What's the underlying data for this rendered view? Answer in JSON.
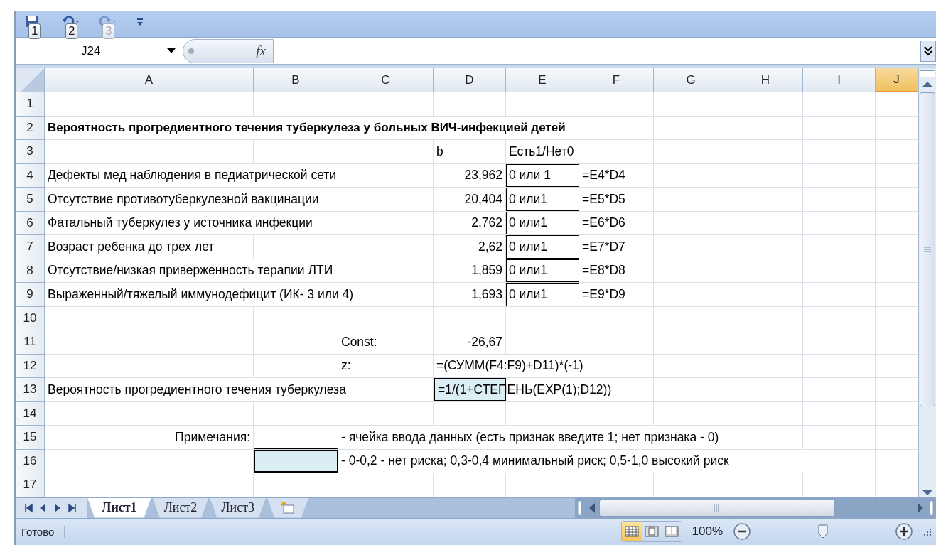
{
  "quick_access": [
    {
      "kind": "save",
      "key_tip": "1",
      "disabled": false
    },
    {
      "kind": "undo",
      "key_tip": "2",
      "disabled": false
    },
    {
      "kind": "redo",
      "key_tip": "3",
      "disabled": true
    }
  ],
  "name_box": {
    "value": "J24"
  },
  "formula_bar": {
    "fx_label": "fx"
  },
  "columns": [
    {
      "label": "A",
      "selected": false
    },
    {
      "label": "B",
      "selected": false
    },
    {
      "label": "C",
      "selected": false
    },
    {
      "label": "D",
      "selected": false
    },
    {
      "label": "E",
      "selected": false
    },
    {
      "label": "F",
      "selected": false
    },
    {
      "label": "G",
      "selected": false
    },
    {
      "label": "H",
      "selected": false
    },
    {
      "label": "I",
      "selected": false
    },
    {
      "label": "J",
      "selected": true
    }
  ],
  "rows": [
    {
      "number": "1",
      "cells": {}
    },
    {
      "number": "2",
      "cells": {
        "A": {
          "text": "Вероятность прогредиентного течения туберкулеза у больных ВИЧ-инфекцией детей",
          "kind": "bold"
        }
      }
    },
    {
      "number": "3",
      "cells": {
        "D": {
          "text": "b"
        },
        "E": {
          "text": "Есть1/Нет0"
        }
      }
    },
    {
      "number": "4",
      "cells": {
        "A": {
          "text": "Дефекты мед наблюдения в педиатрической сети"
        },
        "D": {
          "text": "23,962",
          "kind": "number"
        },
        "E": {
          "text": "0 или 1",
          "kind": "input"
        },
        "F": {
          "text": "=E4*D4"
        }
      }
    },
    {
      "number": "5",
      "cells": {
        "A": {
          "text": "Отсутствие противотуберкулезной вакцинации"
        },
        "D": {
          "text": "20,404",
          "kind": "number"
        },
        "E": {
          "text": "0 или1",
          "kind": "input"
        },
        "F": {
          "text": "=E5*D5"
        }
      }
    },
    {
      "number": "6",
      "cells": {
        "A": {
          "text": "Фатальный туберкулез у источника инфекции"
        },
        "D": {
          "text": "2,762",
          "kind": "number"
        },
        "E": {
          "text": "0 или1",
          "kind": "input"
        },
        "F": {
          "text": "=E6*D6"
        }
      }
    },
    {
      "number": "7",
      "cells": {
        "A": {
          "text": "Возраст ребенка до трех лет"
        },
        "D": {
          "text": "2,62",
          "kind": "number"
        },
        "E": {
          "text": "0 или1",
          "kind": "input"
        },
        "F": {
          "text": "=E7*D7"
        }
      }
    },
    {
      "number": "8",
      "cells": {
        "A": {
          "text": "Отсутствие/низкая приверженность терапии ЛТИ"
        },
        "D": {
          "text": "1,859",
          "kind": "number"
        },
        "E": {
          "text": "0 или1",
          "kind": "input"
        },
        "F": {
          "text": "=E8*D8"
        }
      }
    },
    {
      "number": "9",
      "cells": {
        "A": {
          "text": "Выраженный/тяжелый иммунодефицит (ИК- 3 или 4)"
        },
        "D": {
          "text": "1,693",
          "kind": "number"
        },
        "E": {
          "text": "0 или1",
          "kind": "input"
        },
        "F": {
          "text": "=E9*D9"
        }
      }
    },
    {
      "number": "10",
      "cells": {}
    },
    {
      "number": "11",
      "cells": {
        "C": {
          "text": "Const:"
        },
        "D": {
          "text": "-26,67",
          "kind": "number"
        }
      }
    },
    {
      "number": "12",
      "cells": {
        "C": {
          "text": "z:"
        },
        "D": {
          "text": "=(СУММ(F4:F9)+D11)*(-1)"
        }
      }
    },
    {
      "number": "13",
      "cells": {
        "A": {
          "text": "Вероятность прогредиентного течения туберкулеза"
        },
        "D": {
          "text": "=1/(1+СТЕПЕНЬ(EXP(1);D12))",
          "kind": "result"
        }
      }
    },
    {
      "number": "14",
      "cells": {}
    },
    {
      "number": "15",
      "cells": {
        "A": {
          "text": "Примечания:",
          "kind": "label"
        },
        "B": {
          "kind": "input"
        },
        "C": {
          "text": "- ячейка ввода данных (есть признак введите 1; нет признака - 0)"
        }
      }
    },
    {
      "number": "16",
      "cells": {
        "B": {
          "kind": "result"
        },
        "C": {
          "text": "- 0-0,2 - нет риска; 0,3-0,4 минимальный риск; 0,5-1,0 высокий риск"
        }
      }
    },
    {
      "number": "17",
      "cells": {}
    }
  ],
  "sheet_tabs": [
    {
      "label": "Лист1",
      "selected": true
    },
    {
      "label": "Лист2",
      "selected": false
    },
    {
      "label": "Лист3",
      "selected": false
    }
  ],
  "status_bar": {
    "text": "Готово",
    "views": [
      {
        "kind": "normal",
        "selected": true
      },
      {
        "kind": "page-layout",
        "selected": false
      },
      {
        "kind": "page-break",
        "selected": false
      }
    ],
    "zoom": "100%",
    "zoom_slider": {
      "level": 0.5
    }
  }
}
